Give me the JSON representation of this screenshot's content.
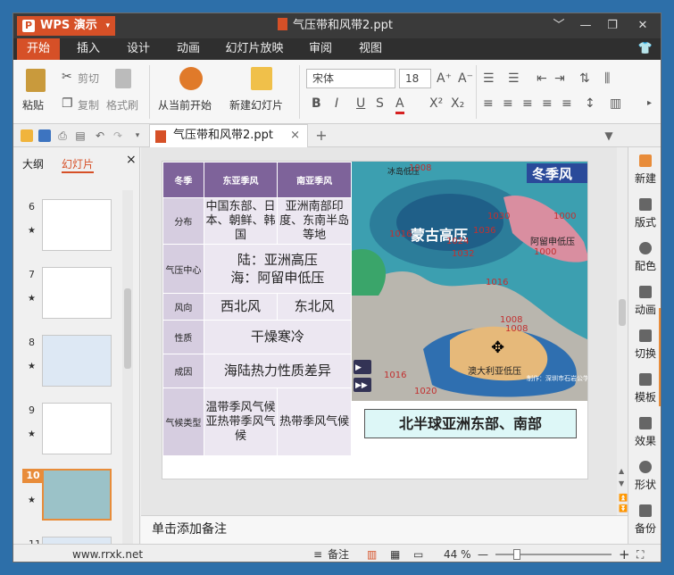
{
  "app": {
    "name": "WPS 演示",
    "doc_title": "气压带和风带2.ppt"
  },
  "window_controls": [
    "﹀",
    "—",
    "❐",
    "✕"
  ],
  "menu": {
    "tabs": [
      "开始",
      "插入",
      "设计",
      "动画",
      "幻灯片放映",
      "审阅",
      "视图"
    ],
    "active": "开始"
  },
  "ribbon": {
    "paste": "粘贴",
    "cut": "剪切",
    "copy": "复制",
    "format_painter": "格式刷",
    "from_current": "从当前开始",
    "new_slide": "新建幻灯片",
    "font_name": "宋体",
    "font_size": "18",
    "bold": "B",
    "italic": "I",
    "underline": "U",
    "font_color": "A",
    "superscript": "X²",
    "subscript": "X₂"
  },
  "doc_tab": {
    "label": "气压带和风带2.ppt",
    "close": "×",
    "add": "+"
  },
  "left_panel": {
    "tab_outline": "大纲",
    "tab_slides": "幻灯片",
    "close": "×",
    "thumbnails": [
      {
        "num": "6",
        "star": "★"
      },
      {
        "num": "7",
        "star": "★"
      },
      {
        "num": "8",
        "star": "★"
      },
      {
        "num": "9",
        "star": "★"
      },
      {
        "num": "10",
        "star": "★"
      },
      {
        "num": "11",
        "star": "★"
      }
    ]
  },
  "slide": {
    "table": {
      "headers": [
        "冬季",
        "东亚季风",
        "南亚季风"
      ],
      "rows": {
        "dist": {
          "label": "分布",
          "east": "中国东部、日本、朝鲜、韩国",
          "south": "亚洲南部印度、东南半岛等地"
        },
        "pressure": {
          "label": "气压中心",
          "value": "陆：亚洲高压 海：阿留申低压"
        },
        "wind": {
          "label": "风向",
          "east": "西北风",
          "south": "东北风"
        },
        "nature": {
          "label": "性质",
          "value": "干燥寒冷"
        },
        "cause": {
          "label": "成因",
          "value": "海陆热力性质差异"
        },
        "climate": {
          "label": "气候类型",
          "east": "温带季风气候 亚热带季风气候",
          "south": "热带季风气候"
        }
      }
    },
    "map": {
      "title": "冬季风",
      "high": "蒙古高压",
      "low1": "冰岛低压",
      "low2": "阿留申低压",
      "low3": "澳大利亚低压",
      "isobars": [
        "1008",
        "1000",
        "1016",
        "1024",
        "1032",
        "1030",
        "1036",
        "1000",
        "1008",
        "1016",
        "1008",
        "1016",
        "1020"
      ],
      "credit": "制作：深圳市石岩公学唐友能"
    },
    "caption": "北半球亚洲东部、南部"
  },
  "notes": {
    "placeholder": "单击添加备注"
  },
  "right_panel": [
    "新建",
    "版式",
    "配色",
    "动画",
    "切换",
    "模板",
    "效果",
    "形状",
    "备份"
  ],
  "status": {
    "website": "www.rrxk.net",
    "notes_btn": "备注",
    "zoom": "44 %",
    "zoom_out": "—",
    "zoom_in": "+"
  },
  "colors": {
    "accent": "#d65027",
    "table_header": "#7e639a",
    "caption_bg": "#ddf7f7"
  }
}
